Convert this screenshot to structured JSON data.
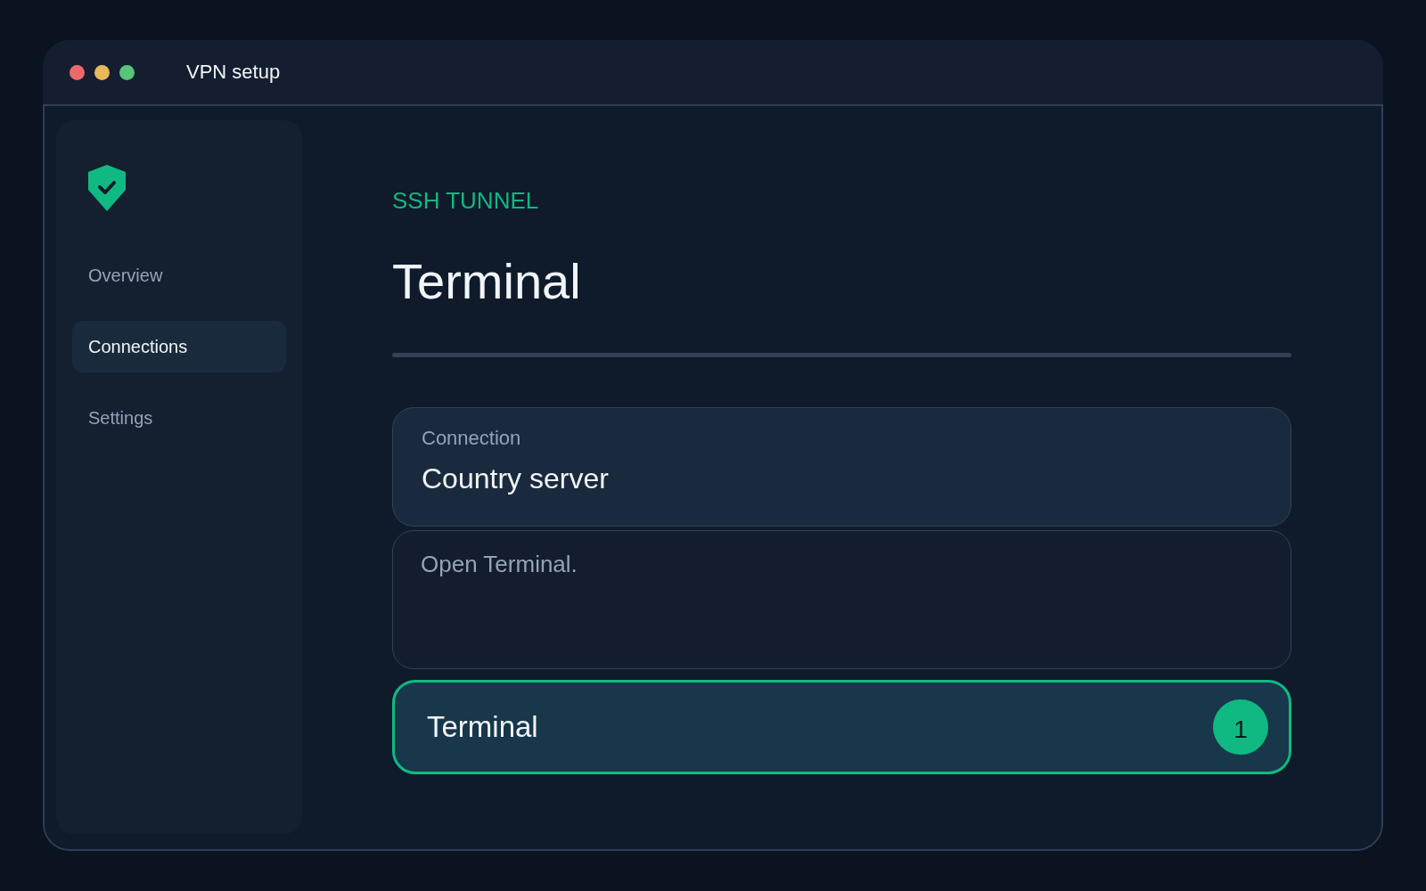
{
  "window": {
    "title": "VPN setup"
  },
  "sidebar": {
    "items": [
      {
        "label": "Overview",
        "selected": false
      },
      {
        "label": "Connections",
        "selected": true
      },
      {
        "label": "Settings",
        "selected": false
      }
    ]
  },
  "main": {
    "eyebrow": "SSH TUNNEL",
    "title": "Terminal",
    "connection_card": {
      "label": "Connection",
      "value": "Country server"
    },
    "message_field": {
      "placeholder": "Open Terminal."
    },
    "action_button": {
      "label": "Terminal",
      "badge": "1",
      "focused": true
    }
  }
}
